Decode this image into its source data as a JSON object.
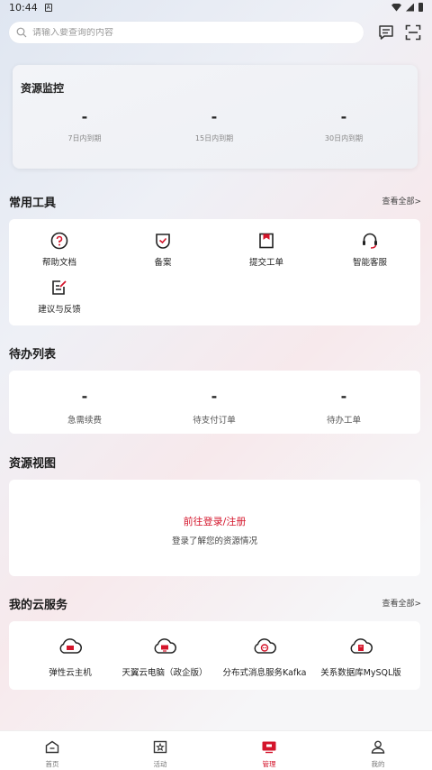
{
  "status_bar": {
    "time": "10:44",
    "notification_glyph": "A"
  },
  "search": {
    "placeholder": "请输入要查询的内容"
  },
  "monitor": {
    "title": "资源监控",
    "stats": [
      {
        "value": "-",
        "label": "7日内到期"
      },
      {
        "value": "-",
        "label": "15日内到期"
      },
      {
        "value": "-",
        "label": "30日内到期"
      }
    ]
  },
  "tools": {
    "title": "常用工具",
    "see_all": "查看全部>",
    "items": [
      {
        "label": "帮助文档",
        "icon": "help-doc-icon"
      },
      {
        "label": "备案",
        "icon": "record-filing-icon"
      },
      {
        "label": "提交工单",
        "icon": "submit-ticket-icon"
      },
      {
        "label": "智能客服",
        "icon": "customer-service-icon"
      },
      {
        "label": "建议与反馈",
        "icon": "feedback-icon"
      }
    ]
  },
  "todo": {
    "title": "待办列表",
    "items": [
      {
        "value": "-",
        "label": "急需续费"
      },
      {
        "value": "-",
        "label": "待支付订单"
      },
      {
        "value": "-",
        "label": "待办工单"
      }
    ]
  },
  "resource_view": {
    "title": "资源视图",
    "login_link": "前往登录/注册",
    "login_hint": "登录了解您的资源情况"
  },
  "cloud_services": {
    "title": "我的云服务",
    "see_all": "查看全部>",
    "items": [
      {
        "label": "弹性云主机",
        "icon": "cloud-host-icon"
      },
      {
        "label": "天翼云电脑（政企版）",
        "icon": "cloud-pc-icon"
      },
      {
        "label": "分布式消息服务Kafka",
        "icon": "kafka-icon"
      },
      {
        "label": "关系数据库MySQL版",
        "icon": "mysql-icon"
      }
    ]
  },
  "bottom_nav": {
    "active": "管理",
    "items": [
      {
        "label": "首页"
      },
      {
        "label": "活动"
      },
      {
        "label": "管理"
      },
      {
        "label": "我的"
      }
    ]
  },
  "colors": {
    "accent": "#d4152b",
    "text": "#222222",
    "muted": "#888888"
  }
}
